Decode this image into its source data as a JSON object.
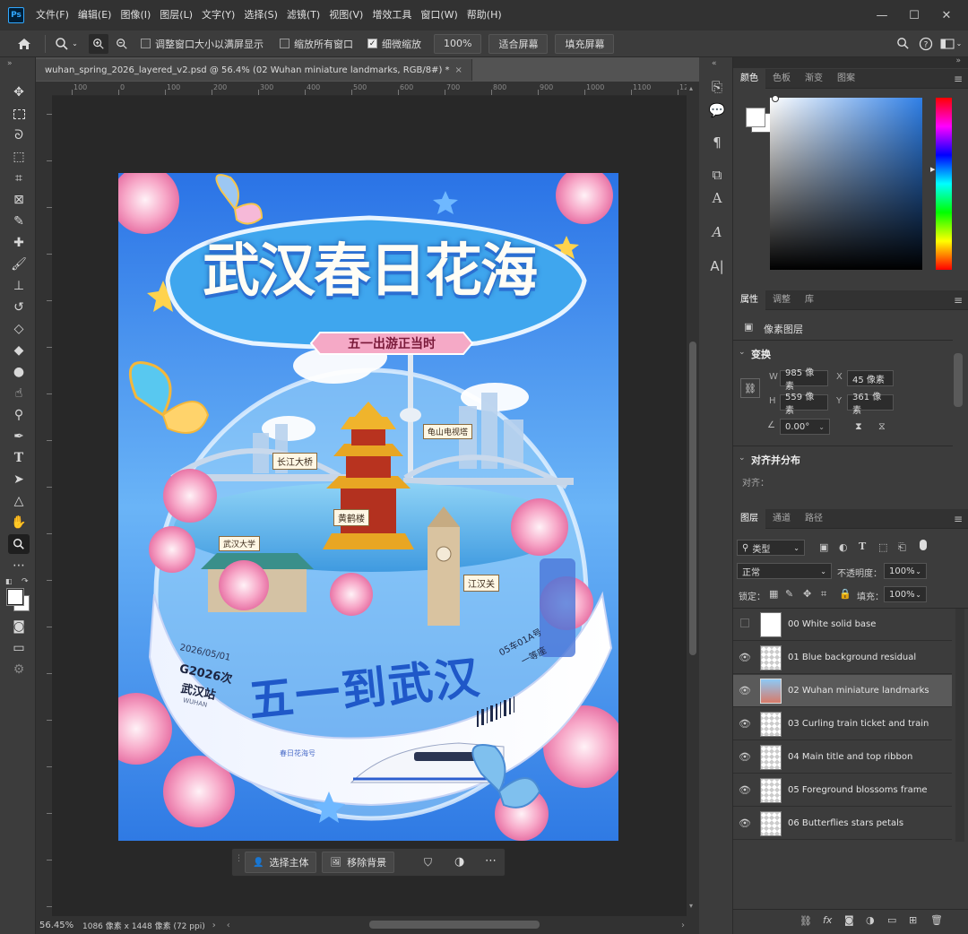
{
  "menubar": {
    "logo": "Ps",
    "items": [
      "文件(F)",
      "编辑(E)",
      "图像(I)",
      "图层(L)",
      "文字(Y)",
      "选择(S)",
      "滤镜(T)",
      "视图(V)",
      "增效工具",
      "窗口(W)",
      "帮助(H)"
    ],
    "window_controls": [
      "minimize-icon",
      "maximize-icon",
      "close-icon"
    ]
  },
  "options": {
    "resize_windows": "调整窗口大小以满屏显示",
    "zoom_all": "缩放所有窗口",
    "scrubby_zoom": "细微缩放",
    "zoom_pct": "100%",
    "fit_screen": "适合屏幕",
    "fill_screen": "填充屏幕"
  },
  "document": {
    "tab_title": "wuhan_spring_2026_layered_v2.psd @ 56.4% (02 Wuhan miniature landmarks, RGB/8#) *",
    "ruler_ticks": [
      "100",
      "0",
      "100",
      "200",
      "300",
      "400",
      "500",
      "600",
      "700",
      "800",
      "900",
      "1000",
      "1100",
      "120"
    ]
  },
  "poster": {
    "title": "武汉春日花海",
    "ribbon": "五一出游正当时",
    "label_bridge": "长江大桥",
    "label_tower": "龟山电视塔",
    "label_hhl": "黄鹤楼",
    "label_univ": "武汉大学",
    "label_jhg": "江汉关",
    "ticket_main": "五一到武汉",
    "ticket_date": "2026/05/01",
    "ticket_train": "G2026次",
    "ticket_station": "武汉站",
    "ticket_station_en": "WUHAN",
    "ticket_seat": "05车01A号",
    "ticket_class": "一等座",
    "ticket_footer": "春日花海号"
  },
  "context_bar": {
    "select_subject": "选择主体",
    "remove_bg": "移除背景"
  },
  "status": {
    "zoom": "56.45%",
    "info": "1086 像素 x 1448 像素 (72 ppi)"
  },
  "color_panel": {
    "tabs": [
      "颜色",
      "色板",
      "渐变",
      "图案"
    ],
    "fg_color": "#ffffff",
    "bg_color": "#ffffff",
    "hue_color": "#2f7fe6"
  },
  "properties": {
    "tabs": [
      "属性",
      "调整",
      "库"
    ],
    "layer_type": "像素图层",
    "transform_title": "变换",
    "w_label": "W",
    "w": "985 像素",
    "h_label": "H",
    "h": "559 像素",
    "x_label": "X",
    "x": "45 像素",
    "y_label": "Y",
    "y": "361 像素",
    "angle": "0.00°",
    "align_title": "对齐并分布",
    "align_label": "对齐："
  },
  "layers_panel": {
    "tabs": [
      "图层",
      "通道",
      "路径"
    ],
    "filter_kind": "类型",
    "blend_mode": "正常",
    "opacity_label": "不透明度：",
    "opacity": "100%",
    "lock_label": "锁定：",
    "fill_label": "填充：",
    "fill": "100%",
    "layers": [
      {
        "name": "00 White solid base",
        "visible": false,
        "selected": false
      },
      {
        "name": "01 Blue background residual",
        "visible": true,
        "selected": false
      },
      {
        "name": "02 Wuhan miniature landmarks",
        "visible": true,
        "selected": true
      },
      {
        "name": "03 Curling train ticket and train",
        "visible": true,
        "selected": false
      },
      {
        "name": "04 Main title and top ribbon",
        "visible": true,
        "selected": false
      },
      {
        "name": "05 Foreground blossoms frame",
        "visible": true,
        "selected": false
      },
      {
        "name": "06 Butterflies stars petals",
        "visible": true,
        "selected": false
      }
    ]
  }
}
